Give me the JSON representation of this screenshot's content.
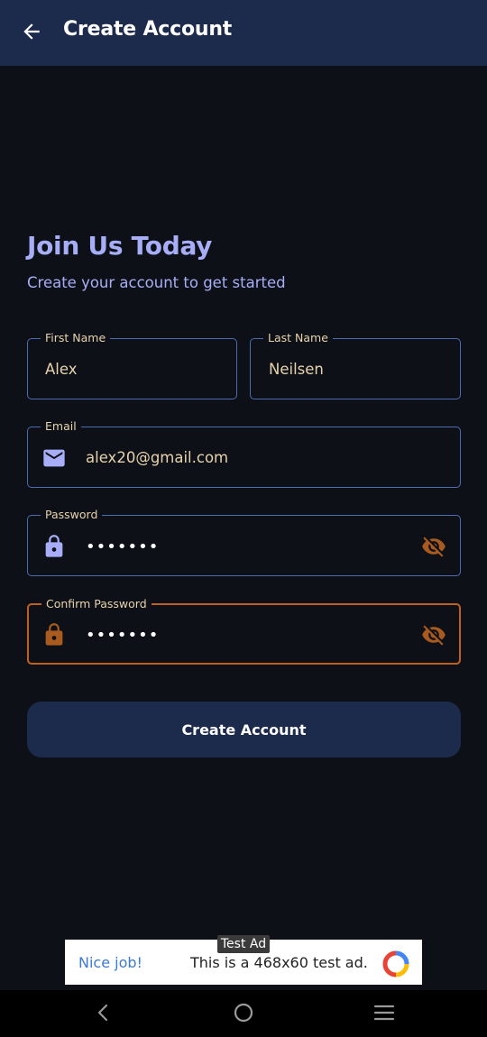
{
  "appbar": {
    "title": "Create Account"
  },
  "intro": {
    "heading": "Join Us Today",
    "subheading": "Create your account to get started"
  },
  "form": {
    "first_name": {
      "label": "First Name",
      "value": "Alex"
    },
    "last_name": {
      "label": "Last Name",
      "value": "Neilsen"
    },
    "email": {
      "label": "Email",
      "value": "alex20@gmail.com",
      "icon": "mail-icon"
    },
    "password": {
      "label": "Password",
      "value": "•••••••",
      "icon": "lock-icon",
      "toggle_icon": "eye-off-icon"
    },
    "confirm_password": {
      "label": "Confirm Password",
      "value": "•••••••",
      "icon": "lock-icon",
      "toggle_icon": "eye-off-icon"
    },
    "submit_label": "Create Account"
  },
  "ad": {
    "tag": "Test Ad",
    "headline": "Nice job!",
    "body": "This is a 468x60 test ad."
  },
  "colors": {
    "appbar": "#1c2a4b",
    "background": "#0d1117",
    "accent": "#a7aef7",
    "field_border": "#4c6bb0",
    "error": "#c0601f",
    "text": "#e7d2ad"
  }
}
